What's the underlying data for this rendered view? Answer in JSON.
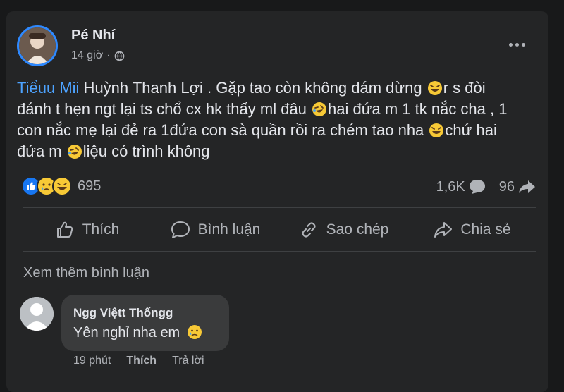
{
  "post": {
    "author": "Pé Nhí",
    "time": "14 giờ",
    "privacy_icon": "globe-icon",
    "tag": "Tiểuu Mii",
    "lines": [
      [
        " Huỳnh Thanh Lợi . Gặp tao còn không dám dừng ",
        "laugh-emoji",
        "r s đòi"
      ],
      [
        "đánh t hẹn ngt lại ts chổ cx hk thấy ml đâu ",
        "rofl-emoji",
        "hai đứa m 1 tk nắc cha , 1"
      ],
      [
        "con nắc mẹ lại đẻ ra 1đứa con sà quần rồi ra chém tao nha ",
        "laugh-emoji",
        "chứ hai"
      ],
      [
        "đứa m ",
        "rofl-emoji",
        "liệu có trình không"
      ]
    ],
    "reaction_icons": [
      "like-icon",
      "sad-icon",
      "haha-icon"
    ],
    "reaction_count": "695",
    "comment_count": "1,6K",
    "share_count": "96"
  },
  "actions": [
    {
      "icon": "thumbs-up-icon",
      "label": "Thích"
    },
    {
      "icon": "comment-icon",
      "label": "Bình luận"
    },
    {
      "icon": "link-icon",
      "label": "Sao chép"
    },
    {
      "icon": "share-icon",
      "label": "Chia sẻ"
    }
  ],
  "see_more": "Xem thêm bình luận",
  "comment": {
    "author": "Ngg Việtt Thốngg",
    "text": "Yên nghỉ nha em",
    "emoji": "sad-emoji",
    "time": "19 phút",
    "like": "Thích",
    "reply": "Trả lời"
  },
  "colors": {
    "background": "#18191a",
    "card": "#242526",
    "tag": "#4da3ff",
    "secondary_text": "#b0b3b8",
    "comment_bubble": "#3a3b3c"
  }
}
